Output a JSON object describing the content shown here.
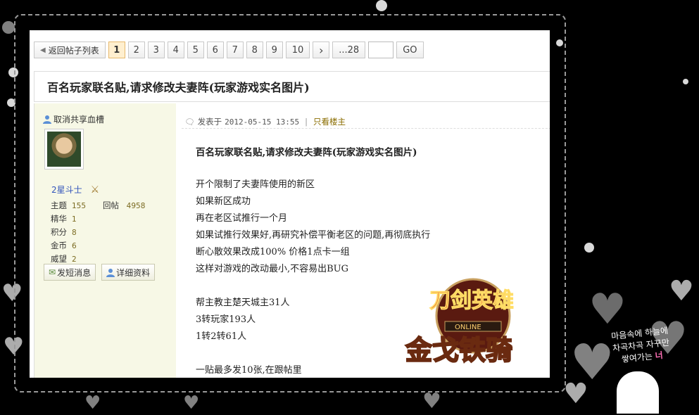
{
  "pager": {
    "back_label": "返回帖子列表",
    "pages": [
      "1",
      "2",
      "3",
      "4",
      "5",
      "6",
      "7",
      "8",
      "9",
      "10"
    ],
    "current": "1",
    "next_label": "›",
    "last_label": "...28",
    "go_label": "GO"
  },
  "post": {
    "title": "百名玩家联名贴,请求修改夫妻阵(玩家游戏实名图片)",
    "meta_prefix": "发表于",
    "datetime": "2012-05-15 13:55",
    "only_author": "只看楼主",
    "body_title": "百名玩家联名贴,请求修改夫妻阵(玩家游戏实名图片)",
    "lines": [
      "开个限制了夫妻阵使用的新区",
      "如果新区成功",
      "再在老区试推行一个月",
      "如果试推行效果好,再研究补偿平衡老区的问题,再彻底执行",
      "断心散效果改成100% 价格1点卡一组",
      "这样对游戏的改动最小,不容易出BUG",
      "",
      "帮主教主楚天城主31人",
      "3转玩家193人",
      "1转2转61人",
      "",
      "一贴最多发10张,在跟帖里"
    ]
  },
  "author": {
    "name": "取消共享血槽",
    "rank": "2星斗士",
    "stats": [
      {
        "label": "主题",
        "value": "155"
      },
      {
        "label": "精华",
        "value": "1"
      },
      {
        "label": "积分",
        "value": "8"
      },
      {
        "label": "金币",
        "value": "6"
      },
      {
        "label": "威望",
        "value": "2"
      }
    ],
    "posts_label": "回帖",
    "posts_value": "4958",
    "pm_label": "发短消息",
    "profile_label": "详细资料"
  },
  "logo": {
    "top_text": "刀剑英雄",
    "online_text": "ONLINE",
    "bottom_text": "金戈铁骑"
  },
  "decor": {
    "korean_line1": "마음속에 하늘에",
    "korean_line2": "차곡차곡 자꾸만",
    "korean_line3": "쌓여가는",
    "korean_pink": "너"
  }
}
